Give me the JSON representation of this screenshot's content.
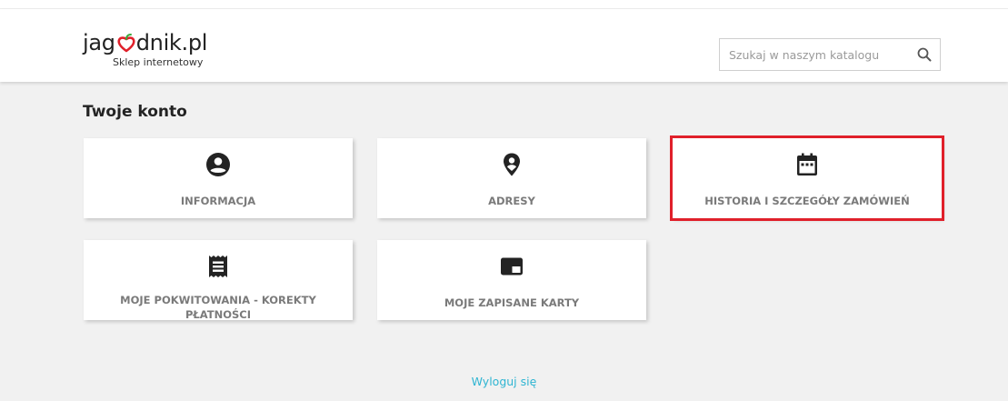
{
  "header": {
    "logo": {
      "name_before": "jag",
      "name_after": "dnik.pl",
      "tagline": "Sklep internetowy",
      "berry_color": "#e0202a",
      "leaf_color": "#3aa83a"
    },
    "search": {
      "placeholder": "Szukaj w naszym katalogu",
      "value": "",
      "icon": "search-icon"
    }
  },
  "main": {
    "title": "Twoje konto",
    "cards": [
      {
        "label": "Informacja",
        "icon": "account-circle-icon"
      },
      {
        "label": "Adresy",
        "icon": "map-pin-icon"
      },
      {
        "label": "Historia i szczegóły zamówień",
        "icon": "calendar-icon",
        "highlighted": true
      },
      {
        "label": "Moje pokwitowania - korekty płatności",
        "icon": "receipt-icon"
      },
      {
        "label": "Moje zapisane karty",
        "icon": "credit-card-icon"
      }
    ],
    "logout_label": "Wyloguj się"
  },
  "colors": {
    "background": "#f1f1f1",
    "card_text": "#7a7a7a",
    "link": "#2fb5d2",
    "highlight": "#e0202a"
  }
}
